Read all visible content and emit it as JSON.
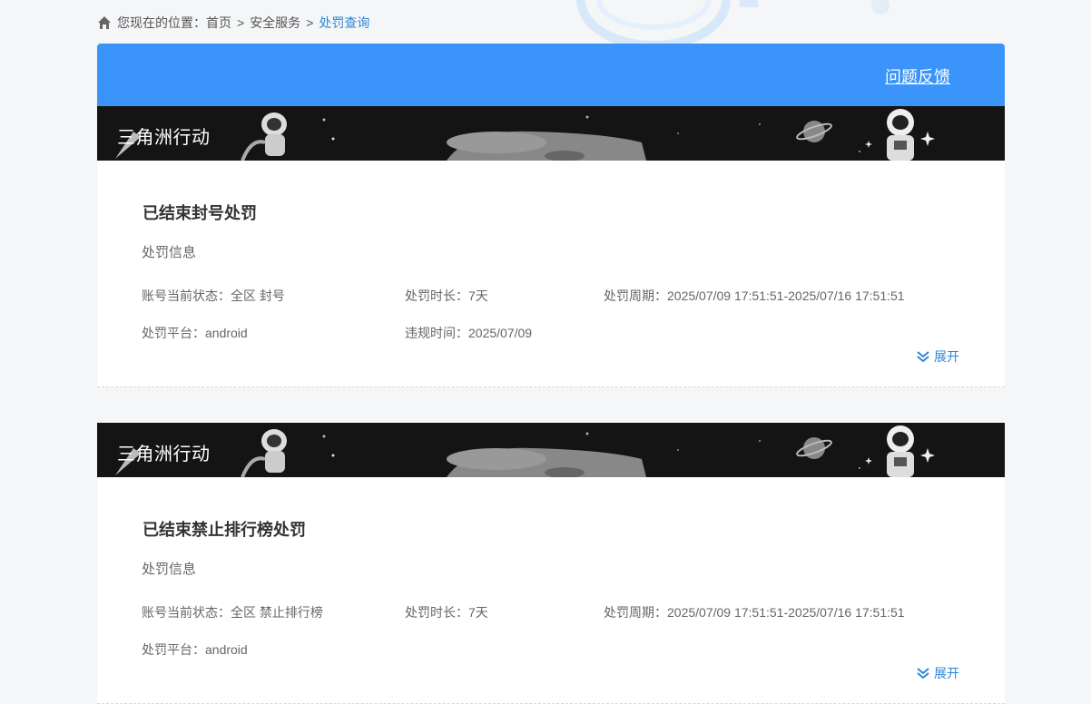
{
  "breadcrumb": {
    "prefix": "您现在的位置：",
    "items": [
      "首页",
      "安全服务",
      "处罚查询"
    ],
    "separator": ">"
  },
  "header": {
    "feedback_label": "问题反馈"
  },
  "colors": {
    "header_blue": "#3a94fa",
    "link_blue": "#2b86d9",
    "banner_dark": "#141414"
  },
  "cards": [
    {
      "game_name": "三角洲行动",
      "title": "已结束封号处罚",
      "section_label": "处罚信息",
      "account_status": "账号当前状态：全区 封号",
      "duration": "处罚时长：7天",
      "period": "处罚周期：2025/07/09 17:51:51-2025/07/16 17:51:51",
      "platform": "处罚平台：android",
      "violation_time": "违规时间：2025/07/09",
      "expand_label": "展开"
    },
    {
      "game_name": "三角洲行动",
      "title": "已结束禁止排行榜处罚",
      "section_label": "处罚信息",
      "account_status": "账号当前状态：全区 禁止排行榜",
      "duration": "处罚时长：7天",
      "period": "处罚周期：2025/07/09 17:51:51-2025/07/16 17:51:51",
      "platform": "处罚平台：android",
      "expand_label": "展开"
    }
  ]
}
